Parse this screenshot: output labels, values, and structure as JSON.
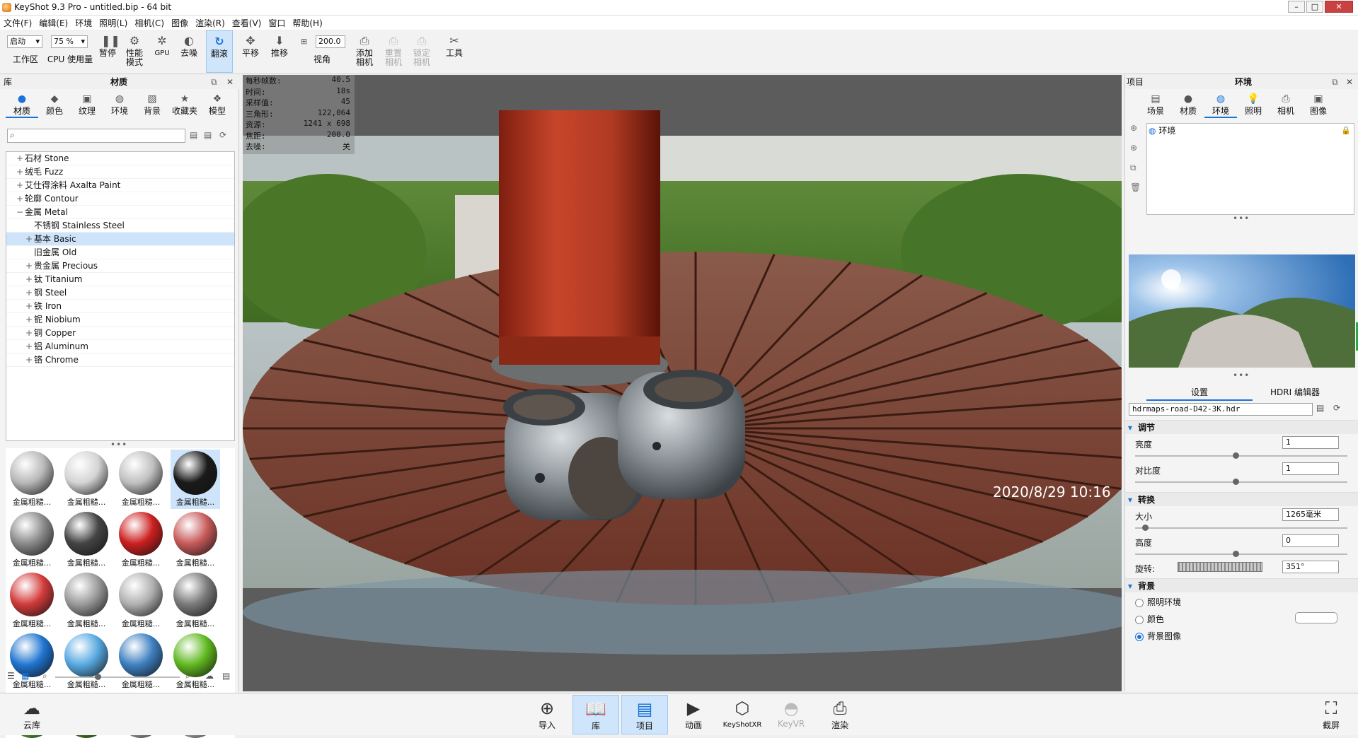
{
  "window": {
    "title": "KeyShot 9.3 Pro  - untitled.bip  - 64 bit"
  },
  "menu": [
    "文件(F)",
    "编辑(E)",
    "环境",
    "照明(L)",
    "相机(C)",
    "图像",
    "渲染(R)",
    "查看(V)",
    "窗口",
    "帮助(H)"
  ],
  "toolbar": {
    "workspace_value": "启动",
    "workspace_label": "工作区",
    "cpu_value": "75 %",
    "cpu_label": "CPU 使用量",
    "pause": "暂停",
    "perf_mode": "性能\n模式",
    "gpu": "GPU",
    "denoise": "去噪",
    "tumble": "翻滚",
    "pan": "平移",
    "dolly": "推移",
    "fov_value": "200.0",
    "fov_label": "视角",
    "add_camera": "添加\n相机",
    "reset_camera": "重置\n相机",
    "lock_camera": "锁定\n相机",
    "tools": "工具"
  },
  "library": {
    "header": "库",
    "title": "材质",
    "tabs": [
      "材质",
      "颜色",
      "纹理",
      "环境",
      "背景",
      "收藏夹",
      "模型"
    ],
    "search_placeholder": "",
    "tree": [
      {
        "label": "石材 Stone",
        "indent": 0,
        "expander": "+"
      },
      {
        "label": "绒毛 Fuzz",
        "indent": 0,
        "expander": "+"
      },
      {
        "label": "艾仕得涂料 Axalta Paint",
        "indent": 0,
        "expander": "+"
      },
      {
        "label": "轮廓 Contour",
        "indent": 0,
        "expander": "+"
      },
      {
        "label": "金属 Metal",
        "indent": 0,
        "expander": "−"
      },
      {
        "label": "不锈钢 Stainless Steel",
        "indent": 1,
        "expander": ""
      },
      {
        "label": "基本 Basic",
        "indent": 1,
        "expander": "+",
        "selected": true
      },
      {
        "label": "旧金属 Old",
        "indent": 1,
        "expander": ""
      },
      {
        "label": "贵金属 Precious",
        "indent": 1,
        "expander": "+"
      },
      {
        "label": "钛 Titanium",
        "indent": 1,
        "expander": "+"
      },
      {
        "label": "钢 Steel",
        "indent": 1,
        "expander": "+"
      },
      {
        "label": "铁 Iron",
        "indent": 1,
        "expander": "+"
      },
      {
        "label": "铌 Niobium",
        "indent": 1,
        "expander": "+"
      },
      {
        "label": "铜 Copper",
        "indent": 1,
        "expander": "+"
      },
      {
        "label": "铝 Aluminum",
        "indent": 1,
        "expander": "+"
      },
      {
        "label": "铬 Chrome",
        "indent": 1,
        "expander": "+"
      }
    ],
    "swatches": [
      {
        "label": "金属粗糙...",
        "color": "#b8b8b8"
      },
      {
        "label": "金属粗糙...",
        "color": "#d4d4d4"
      },
      {
        "label": "金属粗糙...",
        "color": "#c0c0c0"
      },
      {
        "label": "金属粗糙...",
        "color": "#1a1a1a",
        "selected": true
      },
      {
        "label": "金属粗糙...",
        "color": "#8a8a8a"
      },
      {
        "label": "金属粗糙...",
        "color": "#444444"
      },
      {
        "label": "金属粗糙...",
        "color": "#cc1f1f"
      },
      {
        "label": "金属粗糙...",
        "color": "#c85a5a"
      },
      {
        "label": "金属粗糙...",
        "color": "#d23a3a"
      },
      {
        "label": "金属粗糙...",
        "color": "#9a9a9a"
      },
      {
        "label": "金属粗糙...",
        "color": "#b0b0b0"
      },
      {
        "label": "金属粗糙...",
        "color": "#7a7a7a"
      },
      {
        "label": "金属粗糙...",
        "color": "#1f74d0"
      },
      {
        "label": "金属粗糙...",
        "color": "#56a8e0"
      },
      {
        "label": "金属粗糙...",
        "color": "#3d7fc0"
      },
      {
        "label": "金属粗糙...",
        "color": "#5fb81f"
      },
      {
        "label": "金属粗糙...",
        "color": "#68bf3c"
      },
      {
        "label": "金属粗糙...",
        "color": "#4fa02a"
      },
      {
        "label": "金属粗糙...",
        "color": "#c4c4c4"
      },
      {
        "label": "金属粗糙...",
        "color": "#d8d8d8"
      }
    ]
  },
  "stats": [
    {
      "k": "每秒帧数:",
      "v": "40.5"
    },
    {
      "k": "时间:",
      "v": "18s"
    },
    {
      "k": "采样值:",
      "v": "45"
    },
    {
      "k": "三角形:",
      "v": "122,064"
    },
    {
      "k": "资源:",
      "v": "1241 x 698"
    },
    {
      "k": "焦距:",
      "v": "200.0"
    },
    {
      "k": "去噪:",
      "v": "关"
    }
  ],
  "viewport": {
    "timestamp": "2020/8/29  10:16"
  },
  "project": {
    "header": "项目",
    "title": "环境",
    "tabs": [
      "场景",
      "材质",
      "环境",
      "照明",
      "相机",
      "图像"
    ],
    "env_item": "环境",
    "subtabs": [
      "设置",
      "HDRI 编辑器"
    ],
    "hdr_file": "hdrmaps-road-D42-3K.hdr",
    "adjust": {
      "title": "调节",
      "brightness_label": "亮度",
      "brightness": "1",
      "contrast_label": "对比度",
      "contrast": "1"
    },
    "transform": {
      "title": "转换",
      "size_label": "大小",
      "size": "1265毫米",
      "height_label": "高度",
      "height": "0",
      "rotation_label": "旋转:",
      "rotation": "351°"
    },
    "background": {
      "title": "背景",
      "options": [
        "照明环境",
        "颜色",
        "背景图像"
      ],
      "selected": "背景图像"
    }
  },
  "bottom": {
    "cloud": "云库",
    "buttons": [
      "导入",
      "库",
      "项目",
      "动画",
      "KeyShotXR",
      "KeyVR",
      "渲染"
    ],
    "screenshot": "截屏"
  }
}
